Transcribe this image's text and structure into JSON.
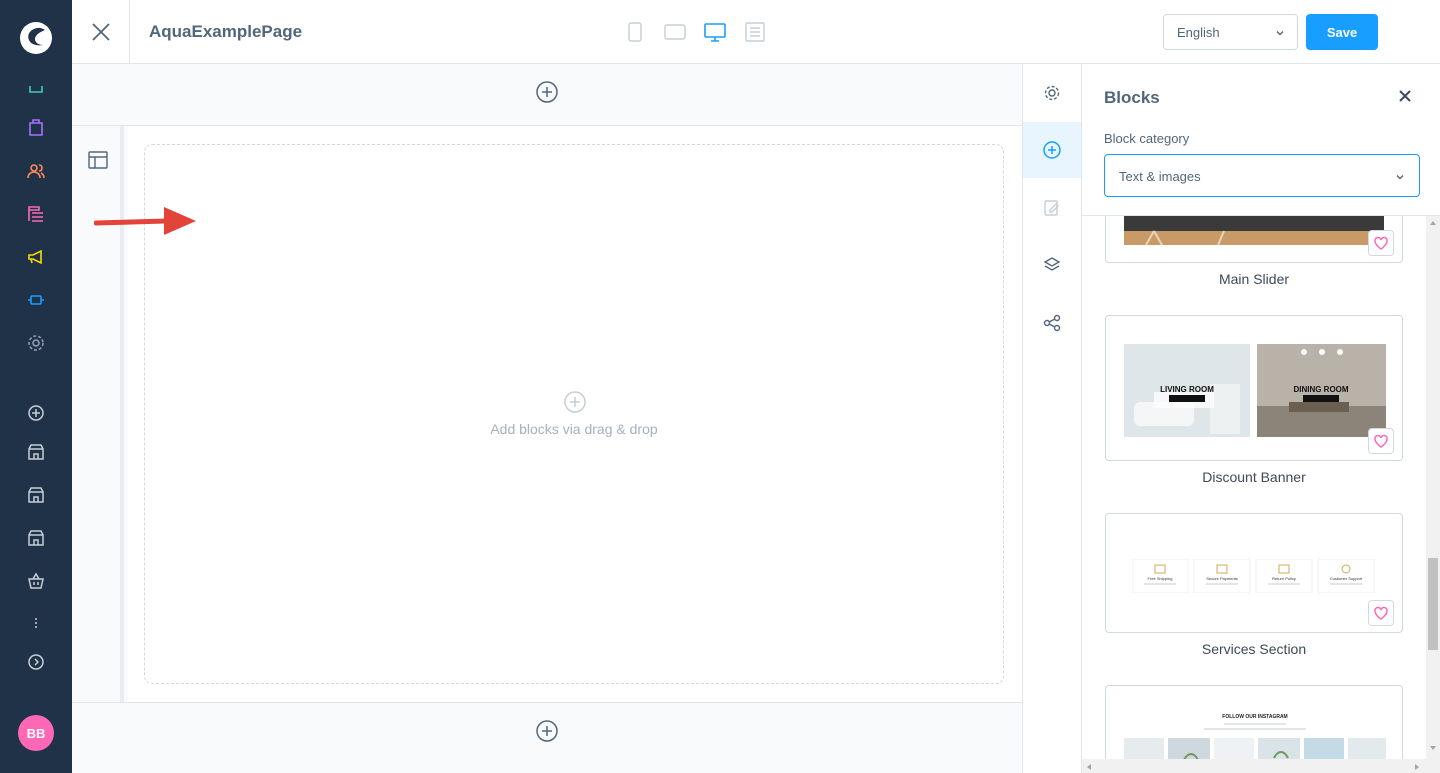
{
  "header": {
    "page_title": "AquaExamplePage",
    "language": "English",
    "save_label": "Save"
  },
  "canvas": {
    "dropzone_text": "Add blocks via drag & drop"
  },
  "user": {
    "initials": "BB"
  },
  "panel": {
    "title": "Blocks",
    "category_label": "Block category",
    "category_value": "Text & images",
    "blocks": [
      {
        "label": "Main Slider"
      },
      {
        "label": "Discount Banner",
        "tiles": [
          "LIVING ROOM",
          "DINING ROOM"
        ]
      },
      {
        "label": "Services Section",
        "items": [
          "Free Shipping",
          "Secure Payments",
          "Return Policy",
          "Customer Support"
        ]
      },
      {
        "title": "FOLLOW OUR INSTAGRAM"
      }
    ]
  },
  "colors": {
    "nav_bg": "#1f3248",
    "accent": "#189eff",
    "avatar": "#ff68b4",
    "arrow": "#e2443a"
  }
}
